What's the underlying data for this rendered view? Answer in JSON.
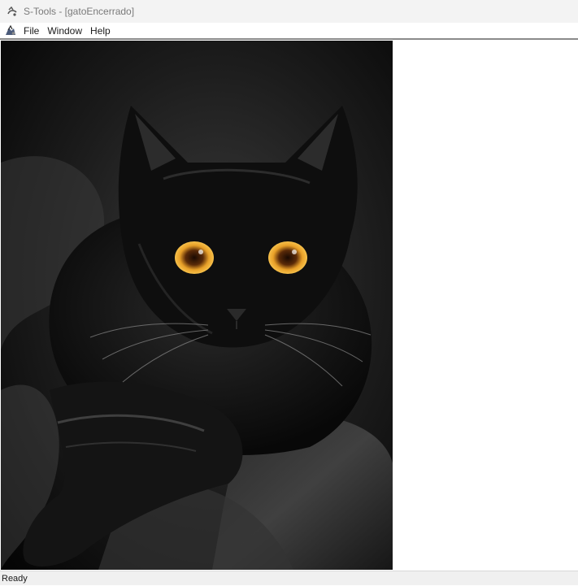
{
  "window": {
    "title": "S-Tools - [gatoEncerrado]",
    "app_icon": "s-tools-icon"
  },
  "menu": {
    "items": [
      {
        "label": "File"
      },
      {
        "label": "Window"
      },
      {
        "label": "Help"
      }
    ]
  },
  "document": {
    "image_subject": "black cat with amber eyes on dark fabric",
    "colors": {
      "background": "#0c0c0c",
      "eyes": "#e8a028"
    }
  },
  "status": {
    "text": "Ready"
  }
}
